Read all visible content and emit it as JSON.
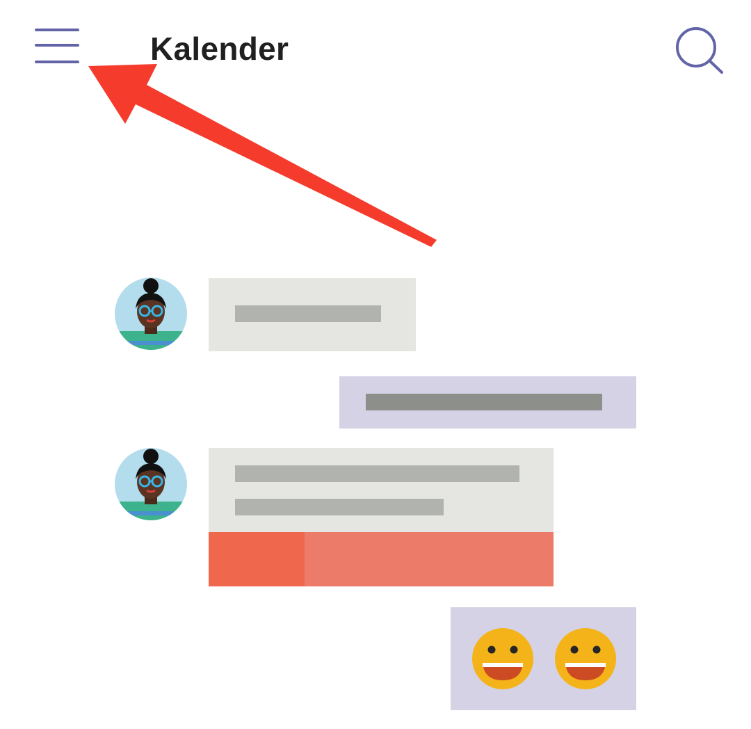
{
  "header": {
    "title": "Kalender",
    "menu_icon": "hamburger-menu-icon",
    "search_icon": "search-icon"
  },
  "colors": {
    "accent": "#6264a7",
    "annotation_arrow": "#f43b2c",
    "incoming_bubble": "#e5e6e1",
    "outgoing_bubble": "#d4d2e4",
    "attachment": "#ec7b6a",
    "attachment_icon": "#ef684d",
    "emoji_face": "#f5b31a"
  },
  "illustration": {
    "messages": [
      {
        "direction": "incoming",
        "avatar": "person-avatar",
        "placeholder_lines": 1
      },
      {
        "direction": "outgoing",
        "placeholder_lines": 1
      },
      {
        "direction": "incoming",
        "avatar": "person-avatar",
        "placeholder_lines": 2,
        "attachment": true
      },
      {
        "direction": "outgoing",
        "emoji": [
          "smiley-emoji-icon",
          "smiley-emoji-icon"
        ]
      }
    ]
  }
}
